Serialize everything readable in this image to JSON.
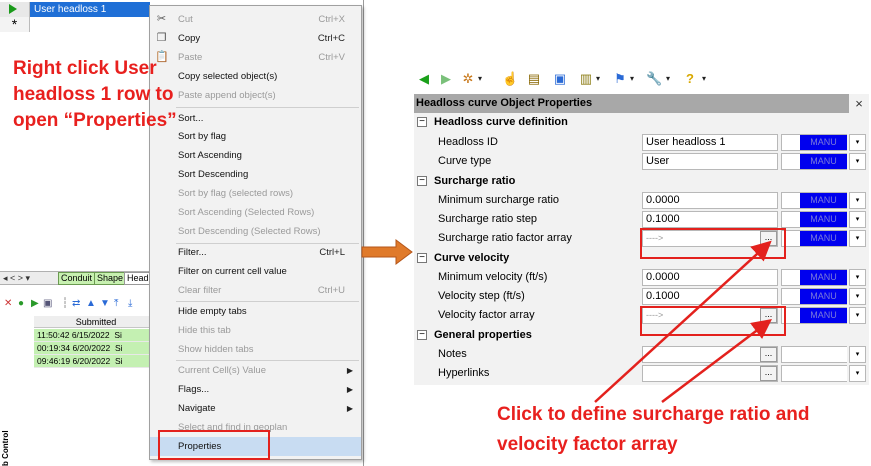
{
  "grid": {
    "row1_text": "User headloss 1",
    "row2_marker": "*"
  },
  "tabs": {
    "nav": "◂  <  >  ▾",
    "items": [
      "Conduit",
      "Shape",
      "Headl"
    ]
  },
  "results": {
    "header": "Submitted",
    "rows": [
      {
        "time": "11:50:42 6/15/2022",
        "extra": "Si"
      },
      {
        "time": "00:19:34 6/20/2022",
        "extra": "Si"
      },
      {
        "time": "09:46:19 6/20/2022",
        "extra": "Si"
      }
    ],
    "job_control_label": "b Control"
  },
  "context_menu": {
    "cut": {
      "label": "Cut",
      "shortcut": "Ctrl+X"
    },
    "copy": {
      "label": "Copy",
      "shortcut": "Ctrl+C"
    },
    "paste": {
      "label": "Paste",
      "shortcut": "Ctrl+V"
    },
    "copy_selected": "Copy selected object(s)",
    "paste_append": "Paste append object(s)",
    "sort": "Sort...",
    "sort_by_flag": "Sort by flag",
    "sort_ascending": "Sort Ascending",
    "sort_descending": "Sort Descending",
    "sort_by_flag_sel": "Sort by flag (selected rows)",
    "sort_ascending_sel": "Sort Ascending (Selected Rows)",
    "sort_descending_sel": "Sort Descending (Selected Rows)",
    "filter": {
      "label": "Filter...",
      "shortcut": "Ctrl+L"
    },
    "filter_on_cell": "Filter on current cell value",
    "clear_filter": {
      "label": "Clear filter",
      "shortcut": "Ctrl+U"
    },
    "hide_empty_tabs": "Hide empty tabs",
    "hide_this_tab": "Hide this tab",
    "show_hidden_tabs": "Show hidden tabs",
    "current_cell_value": "Current Cell(s) Value",
    "flags": "Flags...",
    "navigate": "Navigate",
    "select_find": "Select and find in geoplan",
    "properties": "Properties"
  },
  "annotations": {
    "left": "Right click User headloss 1 row to open “Properties”",
    "right": "Click to define surcharge ratio and velocity factor array"
  },
  "properties_window": {
    "title": "Headloss curve Object Properties",
    "close_glyph": "×",
    "categories": {
      "definition": "Headloss curve definition",
      "surcharge": "Surcharge ratio",
      "velocity": "Curve velocity",
      "general": "General properties"
    },
    "rows": {
      "headloss_id": {
        "label": "Headloss ID",
        "value": "User headloss 1",
        "mode": "MANU"
      },
      "curve_type": {
        "label": "Curve type",
        "value": "User",
        "mode": "MANU"
      },
      "min_surcharge": {
        "label": "Minimum surcharge ratio",
        "value": "0.0000",
        "mode": "MANU"
      },
      "surcharge_step": {
        "label": "Surcharge ratio step",
        "value": "0.1000",
        "mode": "MANU"
      },
      "surcharge_factor": {
        "label": "Surcharge ratio factor array",
        "value": "---->",
        "mode": "MANU"
      },
      "min_velocity": {
        "label": "Minimum velocity (ft/s)",
        "value": "0.0000",
        "mode": "MANU"
      },
      "velocity_step": {
        "label": "Velocity step (ft/s)",
        "value": "0.1000",
        "mode": "MANU"
      },
      "velocity_factor": {
        "label": "Velocity factor array",
        "value": "---->",
        "mode": "MANU"
      },
      "notes": {
        "label": "Notes",
        "value": ""
      },
      "hyperlinks": {
        "label": "Hyperlinks",
        "value": ""
      }
    },
    "ellipsis": "...",
    "dropdown_glyph": "▾"
  },
  "colors": {
    "annotation_red": "#e8201e",
    "selection_blue": "#1f6fd6",
    "manu_blue": "#0000ee",
    "results_green": "#c4f0b2",
    "arrow_orange": "#e07a2a"
  },
  "icons": {
    "toolbar": [
      "back-arrow-icon",
      "forward-arrow-icon",
      "network-icon",
      "pointer-hand-icon",
      "report-icon",
      "image-icon",
      "database-icon",
      "flag-icon",
      "wrench-icon",
      "help-icon"
    ]
  }
}
